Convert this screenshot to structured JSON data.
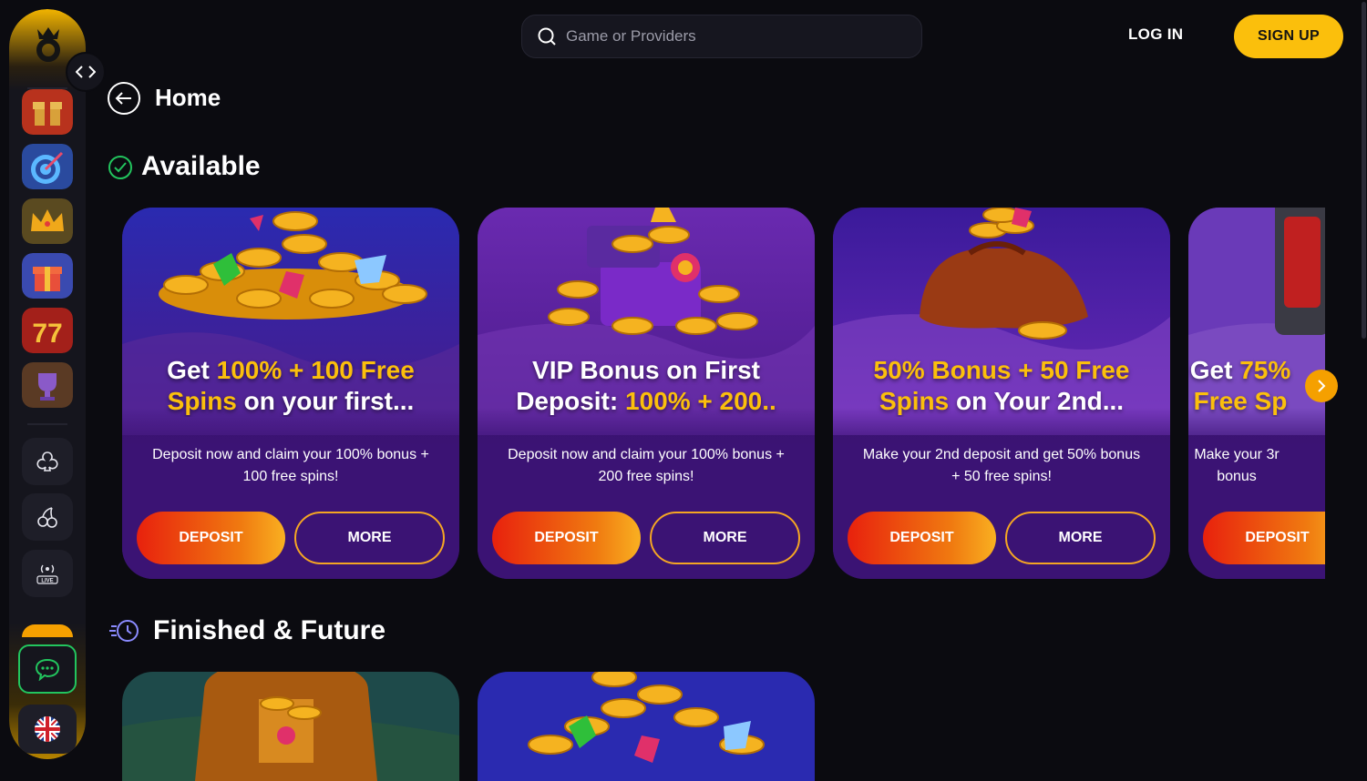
{
  "search": {
    "placeholder": "Game or Providers"
  },
  "header": {
    "login": "LOG IN",
    "signup": "SIGN UP"
  },
  "page": {
    "title": "Home"
  },
  "sections": {
    "available": "Available",
    "finished": "Finished & Future"
  },
  "cards": [
    {
      "title_pre": "Get ",
      "title_hl1": "100% + 100 Free",
      "title_line2_hl": "Spins",
      "title_line2_rest": " on your first...",
      "desc": "Deposit now and claim your 100% bonus + 100 free spins!",
      "deposit": "DEPOSIT",
      "more": "MORE"
    },
    {
      "title_pre": "VIP Bonus on First",
      "title_hl1": "",
      "title_line2_pre": "Deposit: ",
      "title_line2_hl": "100% + 200..",
      "desc": "Deposit now and claim your 100% bonus + 200 free spins!",
      "deposit": "DEPOSIT",
      "more": "MORE"
    },
    {
      "title_hl1": "50% Bonus + 50 Free",
      "title_line2_hl": "Spins",
      "title_line2_rest": " on Your 2nd...",
      "desc": "Make your 2nd deposit and get 50% bonus + 50 free spins!",
      "deposit": "DEPOSIT",
      "more": "MORE"
    },
    {
      "title_pre": "Get ",
      "title_hl1": "75%",
      "title_line2_hl": "Free Sp",
      "desc_line1": "Make your 3r",
      "desc_line2": "bonus",
      "deposit": "DEPOSIT"
    }
  ],
  "colors": {
    "accent": "#fbbf0c",
    "card_bg": "#3b1374",
    "success": "#22c55e"
  }
}
